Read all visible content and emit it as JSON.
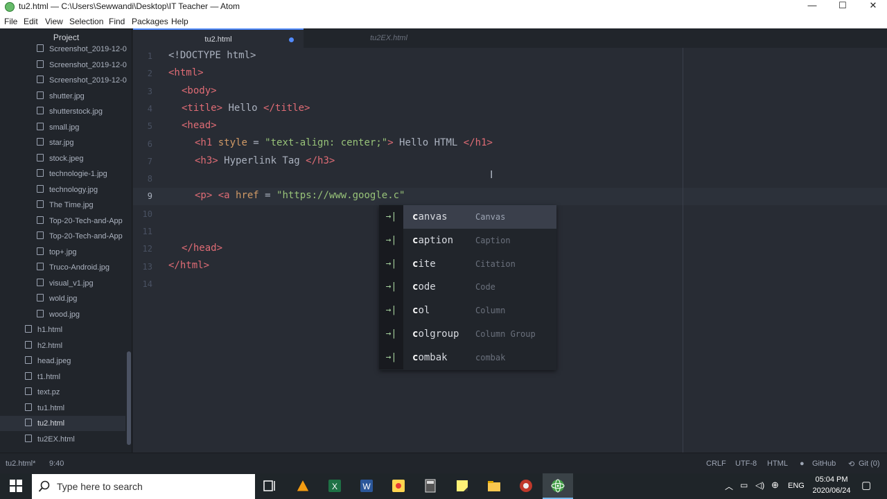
{
  "window": {
    "title": "tu2.html — C:\\Users\\Sewwandi\\Desktop\\IT Teacher — Atom",
    "controls": [
      "—",
      "☐",
      "✕"
    ]
  },
  "menu": [
    "File",
    "Edit",
    "View",
    "Selection",
    "Find",
    "Packages",
    "Help"
  ],
  "tree": {
    "header": "Project",
    "items": [
      {
        "label": "Screenshot_2019-12-0"
      },
      {
        "label": "Screenshot_2019-12-0"
      },
      {
        "label": "Screenshot_2019-12-0"
      },
      {
        "label": "shutter.jpg"
      },
      {
        "label": "shutterstock.jpg"
      },
      {
        "label": "small.jpg"
      },
      {
        "label": "star.jpg"
      },
      {
        "label": "stock.jpeg"
      },
      {
        "label": "technologie-1.jpg"
      },
      {
        "label": "technology.jpg"
      },
      {
        "label": "The Time.jpg"
      },
      {
        "label": "Top-20-Tech-and-App"
      },
      {
        "label": "Top-20-Tech-and-App"
      },
      {
        "label": "top+.jpg"
      },
      {
        "label": "Truco-Android.jpg"
      },
      {
        "label": "visual_v1.jpg"
      },
      {
        "label": "wold.jpg"
      },
      {
        "label": "wood.jpg"
      },
      {
        "label": "h1.html"
      },
      {
        "label": "h2.html"
      },
      {
        "label": "head.jpeg"
      },
      {
        "label": "t1.html"
      },
      {
        "label": "text.pz"
      },
      {
        "label": "tu1.html"
      },
      {
        "label": "tu2.html"
      },
      {
        "label": "tu2EX.html"
      }
    ]
  },
  "tabs": [
    {
      "label": "tu2.html"
    },
    {
      "label": "tu2EX.html"
    }
  ],
  "editor": {
    "line_numbers": [
      "1",
      "2",
      "3",
      "4",
      "5",
      "6",
      "7",
      "8",
      "9",
      "10",
      "11",
      "12",
      "13",
      "14"
    ],
    "lines": {
      "l1": "<!DOCTYPE html>",
      "l2_tag": "<html>",
      "l3_tag": "<body>",
      "l4_a": "<title>",
      "l4_b": " Hello ",
      "l4_c": "</title>",
      "l5_tag": "<head>",
      "l6_a": "<h1",
      "l6_b": " style",
      "l6_c": " = ",
      "l6_d": "\"text-align: center;\"",
      "l6_e": ">",
      "l6_f": " Hello HTML ",
      "l6_g": "</h1>",
      "l7_a": "<h3>",
      "l7_b": " Hyperlink Tag ",
      "l7_c": "</h3>",
      "l9_a": "<p>",
      "l9_b": " ",
      "l9_c": "<a",
      "l9_d": " href",
      "l9_e": " = ",
      "l9_f": "\"https://www.google.c\"",
      "l12_tag": "</head>",
      "l13_tag": "</html>"
    }
  },
  "autocomplete": {
    "icon": "→|",
    "items": [
      {
        "match": "c",
        "rest": "anvas",
        "desc": "Canvas"
      },
      {
        "match": "c",
        "rest": "aption",
        "desc": "Caption"
      },
      {
        "match": "c",
        "rest": "ite",
        "desc": "Citation"
      },
      {
        "match": "c",
        "rest": "ode",
        "desc": "Code"
      },
      {
        "match": "c",
        "rest": "ol",
        "desc": "Column"
      },
      {
        "match": "c",
        "rest": "olgroup",
        "desc": "Column Group"
      },
      {
        "match": "c",
        "rest": "ombak",
        "desc": "combak"
      }
    ]
  },
  "status": {
    "file": "tu2.html*",
    "position": "9:40",
    "line_ending": "CRLF",
    "encoding": "UTF-8",
    "grammar": "HTML",
    "github": "GitHub",
    "git": "Git (0)"
  },
  "taskbar": {
    "search_placeholder": "Type here to search",
    "lang": "ENG",
    "time": "05:04 PM",
    "date": "2020/06/24"
  }
}
